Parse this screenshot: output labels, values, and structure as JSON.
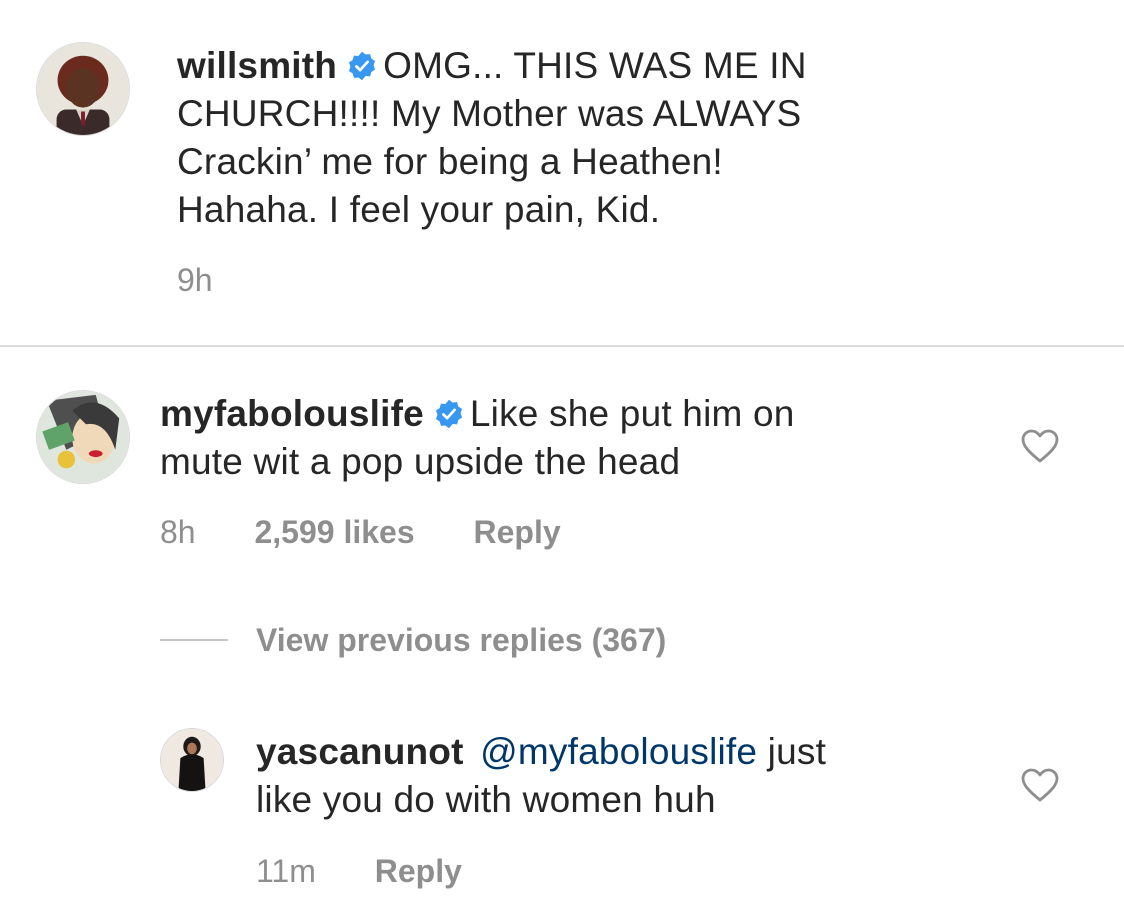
{
  "caption": {
    "username": "willsmith",
    "text": "OMG... THIS WAS ME IN CHURCH!!!! My Mother was ALWAYS Crackin' me for being a Heathen! Hahaha.  I feel your pain, Kid.",
    "line1": "OMG... THIS WAS ME IN",
    "line2": "CHURCH!!!! My Mother was ALWAYS",
    "line3": "Crackin’ me for being a Heathen!",
    "line4": "Hahaha.  I feel your pain, Kid.",
    "time": "9h",
    "verified_icon": "verified-badge-icon",
    "avatar_icon": "avatar-child-photo"
  },
  "comment": {
    "username": "myfabolouslife",
    "line1": "Like she put him on",
    "line2": "mute wit a pop upside the head",
    "time": "8h",
    "likes": "2,599 likes",
    "reply_label": "Reply",
    "verified_icon": "verified-badge-icon",
    "like_icon": "heart-outline-icon",
    "avatar_icon": "avatar-comic-art"
  },
  "thread": {
    "view_previous_label": "View previous replies (367)"
  },
  "reply": {
    "username": "yascanunot",
    "mention": "@myfabolouslife",
    "line1_rest": " just",
    "line2": "like you do with women huh",
    "time": "11m",
    "reply_label": "Reply",
    "like_icon": "heart-outline-icon",
    "avatar_icon": "avatar-person-photo"
  },
  "colors": {
    "text": "#262626",
    "meta": "#8e8e8e",
    "verified_blue": "#3897f0",
    "mention": "#00376b",
    "divider": "#dbdbdb"
  }
}
